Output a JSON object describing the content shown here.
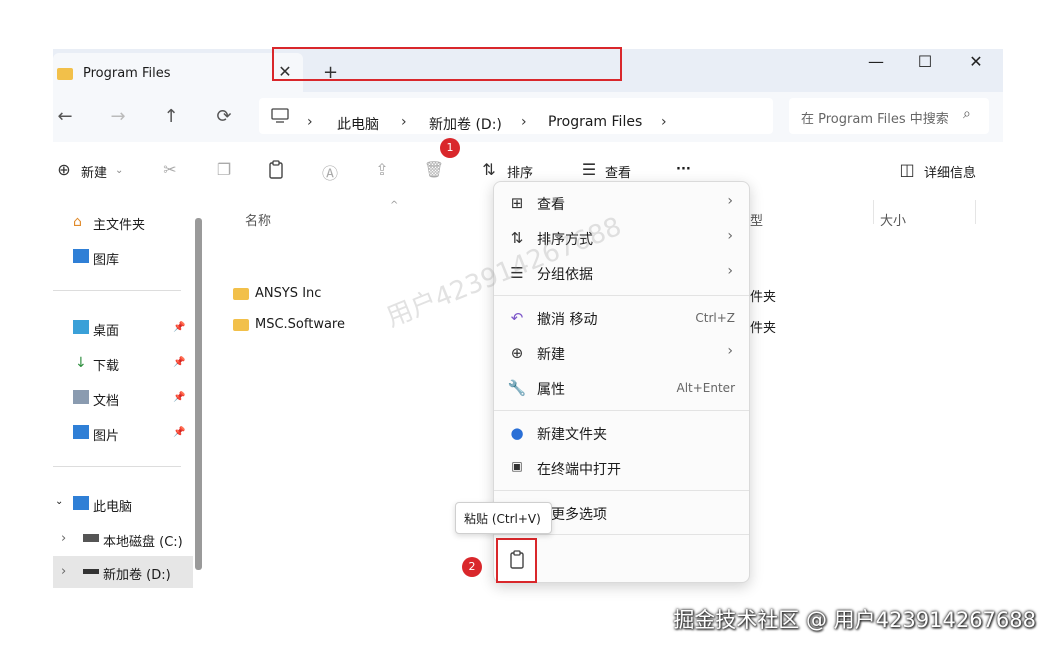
{
  "title_bar": {
    "tab_label": "Program Files",
    "tab_close": "✕",
    "new_tab": "+",
    "minimize": "—",
    "maximize": "☐",
    "close": "✕"
  },
  "address_bar": {
    "breadcrumbs": [
      "此电脑",
      "新加卷 (D:)",
      "Program Files"
    ],
    "separator": "›",
    "search_placeholder": "在 Program Files 中搜索"
  },
  "toolbar": {
    "new_label": "新建",
    "sort_label": "排序",
    "view_label": "查看",
    "more_label": "···",
    "details_label": "详细信息"
  },
  "sidebar": {
    "items": [
      {
        "label": "主文件夹",
        "icon": "home-icon"
      },
      {
        "label": "图库",
        "icon": "gallery-icon"
      },
      {
        "label": "桌面",
        "icon": "desktop-icon"
      },
      {
        "label": "下载",
        "icon": "download-icon"
      },
      {
        "label": "文档",
        "icon": "documents-icon"
      },
      {
        "label": "图片",
        "icon": "pictures-icon"
      },
      {
        "label": "此电脑",
        "icon": "pc-icon"
      },
      {
        "label": "本地磁盘 (C:)",
        "icon": "drive-icon"
      },
      {
        "label": "新加卷 (D:)",
        "icon": "drive-icon"
      }
    ]
  },
  "file_list": {
    "columns": [
      "名称",
      "型",
      "大小"
    ],
    "rows": [
      {
        "name": "ANSYS Inc",
        "type": "件夹"
      },
      {
        "name": "MSC.Software",
        "type": "件夹"
      }
    ]
  },
  "context_menu": {
    "items": [
      {
        "label": "查看",
        "shortcut": "",
        "submenu": true
      },
      {
        "label": "排序方式",
        "shortcut": "",
        "submenu": true
      },
      {
        "label": "分组依据",
        "shortcut": "",
        "submenu": true
      },
      {
        "label": "撤消 移动",
        "shortcut": "Ctrl+Z",
        "submenu": false
      },
      {
        "label": "新建",
        "shortcut": "",
        "submenu": true
      },
      {
        "label": "属性",
        "shortcut": "Alt+Enter",
        "submenu": false
      },
      {
        "label": "新建文件夹",
        "shortcut": "",
        "submenu": false
      },
      {
        "label": "在终端中打开",
        "shortcut": "",
        "submenu": false
      },
      {
        "label": "示更多选项",
        "shortcut": "",
        "submenu": false
      }
    ]
  },
  "tooltip": "粘贴 (Ctrl+V)",
  "badges": {
    "one": "1",
    "two": "2"
  },
  "watermark": "用户423914267688",
  "footer_watermark": "掘金技术社区 @ 用户423914267688",
  "colors": {
    "highlight": "#d9272b",
    "folder": "#f2c04a",
    "titlebar": "#e9eef6"
  }
}
